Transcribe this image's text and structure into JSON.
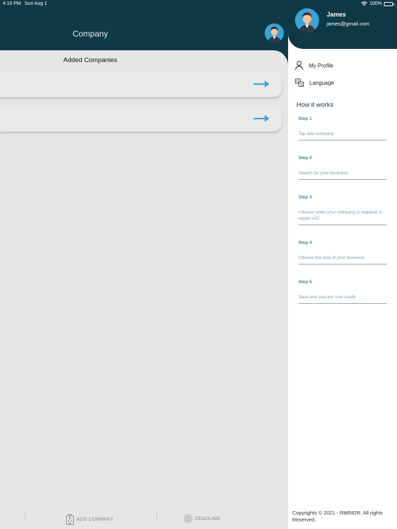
{
  "status_bar": {
    "time": "4:10 PM",
    "date": "Sun Aug 1",
    "battery": "100%"
  },
  "header": {
    "title": "Company"
  },
  "main": {
    "section_title": "Added Companies",
    "companies": [
      {
        "name": ""
      },
      {
        "name": ""
      }
    ]
  },
  "tab_bar": {
    "tabs": [
      {
        "label": "ADD COMPANY",
        "icon": "building-icon"
      },
      {
        "label": "DEADLINE",
        "icon": "deadline-icon"
      }
    ]
  },
  "drawer": {
    "user": {
      "name": "James",
      "email": "james@gmail.com"
    },
    "menu": [
      {
        "label": "My Profile",
        "icon": "person-icon"
      },
      {
        "label": "Language",
        "icon": "translate-icon"
      }
    ],
    "how_it_works": {
      "title": "How it works",
      "steps": [
        {
          "label": "Step 1",
          "text": "Tap add company"
        },
        {
          "label": "Step 2",
          "text": "Search for your business"
        },
        {
          "label": "Step 3",
          "text": "Choose when your company is required to report VAT"
        },
        {
          "label": "Step 4",
          "text": "Choose the size of your business"
        },
        {
          "label": "Step 5",
          "text": "Save and you are now ready"
        }
      ]
    },
    "copyright": "Copyrights © 2021 - RMINDR. All rights Reserved."
  },
  "colors": {
    "header_bg": "#0e3a47",
    "arrow": "#3aa3d6",
    "step_label": "#4f7f93",
    "step_text": "#7aa3b4"
  }
}
